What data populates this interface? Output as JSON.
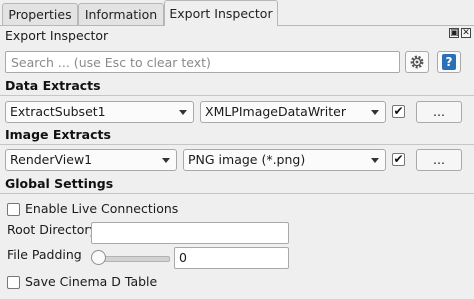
{
  "tabs": [
    {
      "label": "Properties"
    },
    {
      "label": "Information"
    },
    {
      "label": "Export Inspector"
    }
  ],
  "panel": {
    "title": "Export Inspector",
    "float_glyph": "▣",
    "close_glyph": "✕"
  },
  "search": {
    "placeholder": "Search ... (use Esc to clear text)",
    "value": ""
  },
  "toolbar": {
    "settings_icon": "gear-icon",
    "help_label": "?"
  },
  "data_extracts": {
    "heading": "Data Extracts",
    "source": "ExtractSubset1",
    "writer": "XMLPImageDataWriter",
    "checked": "✔",
    "more_label": "..."
  },
  "image_extracts": {
    "heading": "Image Extracts",
    "source": "RenderView1",
    "writer": "PNG image (*.png)",
    "checked": "✔",
    "more_label": "..."
  },
  "global_settings": {
    "heading": "Global Settings",
    "live_connections_label": "Enable Live Connections",
    "root_directory_label": "Root Directory",
    "root_directory_value": "",
    "file_padding_label": "File Padding",
    "file_padding_value": "0",
    "file_padding_level": 0,
    "cinema_label": "Save Cinema D Table"
  },
  "colors": {
    "background": "#efefef",
    "accent_help": "#2a6fb8"
  }
}
